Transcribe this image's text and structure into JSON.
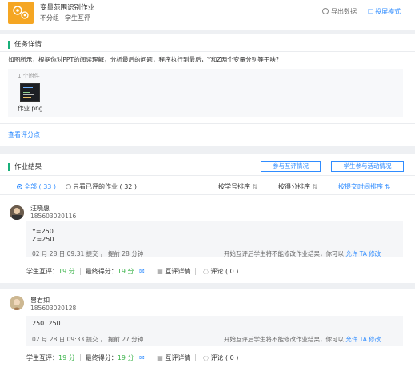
{
  "header": {
    "title": "变量范围识别作业",
    "group": "不分组",
    "eval_type": "学生互评",
    "export_label": "导出数据",
    "projector_label": "投屏模式"
  },
  "task": {
    "section_title": "任务详情",
    "question": "如图所示，根据你对PPT的阅读理解，分析最后的问题，程序执行到最后，Y和Z两个变量分别等于啥？",
    "attachment_count": "1 个附件",
    "attachment_name": "作业.png",
    "view_eval_points": "查看评分点"
  },
  "results": {
    "section_title": "作业结果",
    "btn_peer": "参与互评情况",
    "btn_activity": "学生参与活动情况",
    "filter_all": "全部 ( 33 )",
    "filter_reviewed": "只看已评的作业 ( 32 )",
    "sort_student_id": "按学号排序",
    "sort_score": "按得分排序",
    "sort_time": "按提交时间排序",
    "sort_arrows": "⇅"
  },
  "submissions": [
    {
      "name": "汪晓惠",
      "student_id": "185603020116",
      "answer_lines": [
        "Y=250",
        "Z=250"
      ],
      "submit_info": "02 月 28 日 09:31 提交 ， 提前 28 分钟",
      "notice": "开始互评后学生将不能修改作业结果，你可以",
      "allow_modify": "允许 TA 修改",
      "peer_label": "学生互评：",
      "peer_score": "19 分",
      "final_label": "最终得分：",
      "final_score": "19 分",
      "peer_detail": "互评详情",
      "comment": "评论 ( 0 )"
    },
    {
      "name": "曾君如",
      "student_id": "185603020128",
      "answer_lines": [
        "250  250"
      ],
      "submit_info": "02 月 28 日 09:33 提交 ， 提前 27 分钟",
      "notice": "开始互评后学生将不能修改作业结果，你可以",
      "allow_modify": "允许 TA 修改",
      "peer_label": "学生互评：",
      "peer_score": "19 分",
      "final_label": "最终得分：",
      "final_score": "19 分",
      "peer_detail": "互评详情",
      "comment": "评论 ( 0 )"
    }
  ],
  "colors": {
    "accent_blue": "#2f8cff",
    "section_green": "#19b07a",
    "logo_orange": "#f5a623",
    "score_green": "#3bb34a"
  }
}
